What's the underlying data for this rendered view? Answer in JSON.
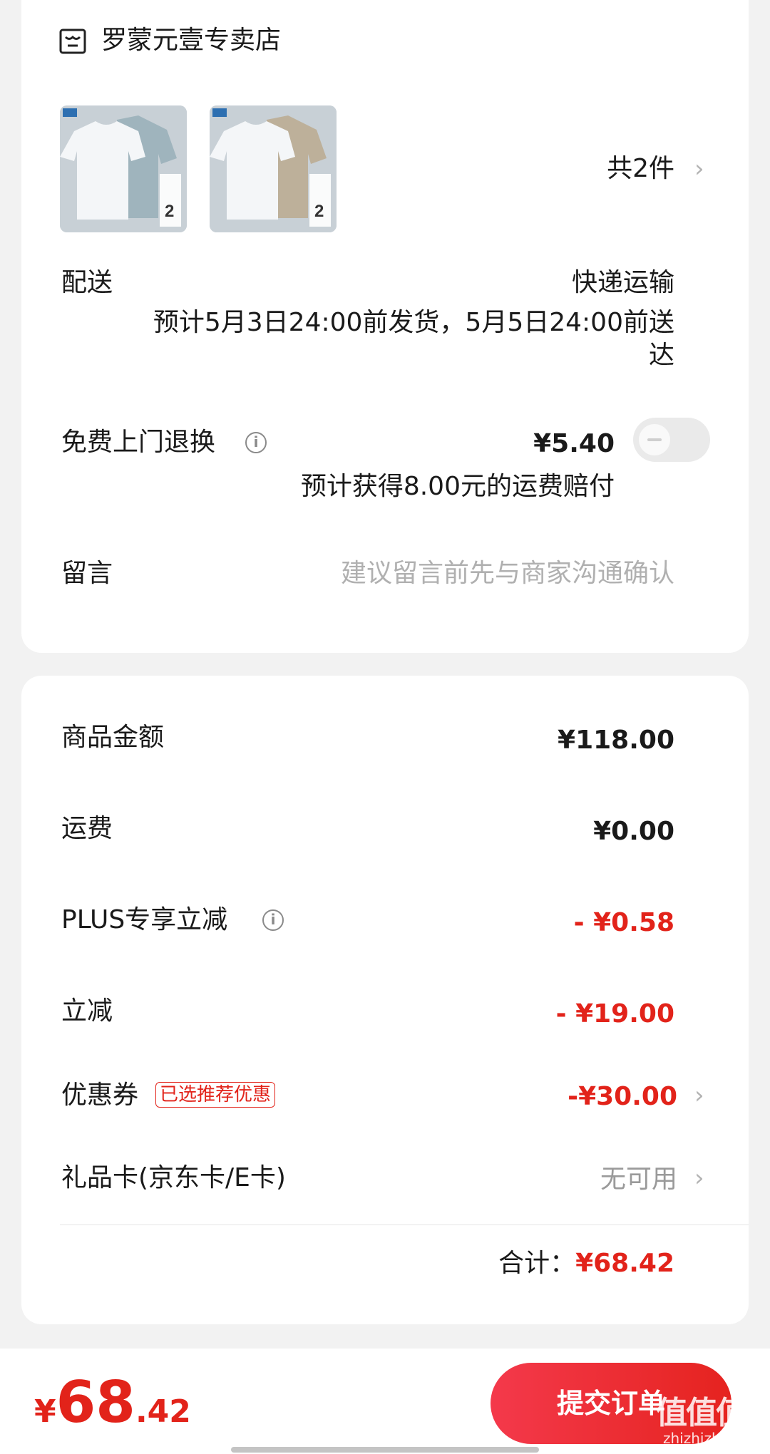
{
  "store": {
    "name": "罗蒙元壹专卖店",
    "icon": "store-icon"
  },
  "products": {
    "thumbs": [
      {
        "label": "product-thumb-1",
        "color2": "#9fb4bd",
        "badge": "2"
      },
      {
        "label": "product-thumb-2",
        "color2": "#bdb09a",
        "badge": "2"
      }
    ],
    "count_label": "共2件"
  },
  "delivery": {
    "label": "配送",
    "method": "快递运输",
    "estimate_line1": "预计5月3日24:00前发货，5月5日24:00前送",
    "estimate_line2": "达"
  },
  "return": {
    "label": "免费上门退换",
    "price": "¥5.40",
    "note": "预计获得8.00元的运费赔付",
    "toggle_on": false
  },
  "message": {
    "label": "留言",
    "placeholder": "建议留言前先与商家沟通确认"
  },
  "summary": {
    "goods_label": "商品金额",
    "goods_value": "¥118.00",
    "shipping_label": "运费",
    "shipping_value": "¥0.00",
    "plus_label": "PLUS专享立减",
    "plus_value": "- ¥0.58",
    "discount_label": "立减",
    "discount_value": "- ¥19.00",
    "coupon_label": "优惠券",
    "coupon_tag": "已选推荐优惠",
    "coupon_value": "-¥30.00",
    "giftcard_label": "礼品卡(京东卡/E卡)",
    "giftcard_value": "无可用",
    "total_label": "合计：",
    "total_value": "¥68.42"
  },
  "bottom": {
    "currency": "¥",
    "price_int": "68",
    "price_dec": ".42",
    "submit_label": "提交订单"
  },
  "watermark": {
    "text": "值值值",
    "sub": "zhizhizhi.com"
  },
  "colors": {
    "accent_red": "#e2231a",
    "button_red": "#f4394b"
  }
}
